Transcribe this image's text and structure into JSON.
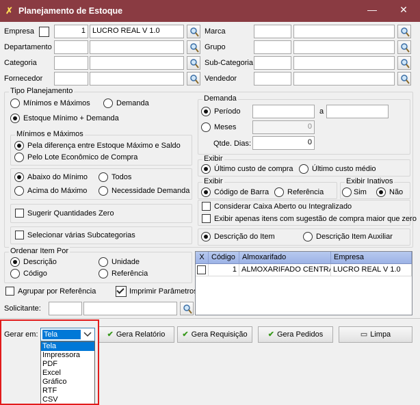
{
  "window": {
    "title": "Planejamento de Estoque",
    "minimize": "—",
    "close": "✕"
  },
  "filters": {
    "empresa": {
      "label": "Empresa",
      "code": "1",
      "name": "LUCRO REAL V 1.0",
      "checked": false
    },
    "departamento": {
      "label": "Departamento",
      "code": "",
      "name": ""
    },
    "categoria": {
      "label": "Categoria",
      "code": "",
      "name": ""
    },
    "fornecedor": {
      "label": "Fornecedor",
      "code": "",
      "name": ""
    },
    "marca": {
      "label": "Marca",
      "code": "",
      "name": ""
    },
    "grupo": {
      "label": "Grupo",
      "code": "",
      "name": ""
    },
    "subcategoria": {
      "label": "Sub-Categoria",
      "code": "",
      "name": ""
    },
    "vendedor": {
      "label": "Vendedor",
      "code": "",
      "name": ""
    }
  },
  "tipo_planejamento": {
    "title": "Tipo Planejamento",
    "opt_minmax": "Mínimos e Máximos",
    "opt_demanda": "Demanda",
    "opt_estoque_demanda": "Estoque Mínimo + Demanda",
    "selected": "Estoque Mínimo + Demanda"
  },
  "minimos_maximos": {
    "title": "Mínimos e Máximos",
    "opt_diferenca": "Pela diferença entre Estoque Máximo e Saldo",
    "opt_lote": "Pelo Lote Econômico de Compra",
    "selected": "Pela diferença entre Estoque Máximo e Saldo"
  },
  "nivel": {
    "opt_abaixo": "Abaixo do Mínimo",
    "opt_todos": "Todos",
    "opt_acima": "Acima do Máximo",
    "opt_necessidade": "Necessidade Demanda",
    "selected": "Abaixo do Mínimo"
  },
  "sugerir": {
    "label": "Sugerir Quantidades Zero",
    "checked": false
  },
  "subcategorias": {
    "label": "Selecionar várias Subcategorias",
    "checked": false
  },
  "demanda": {
    "title": "Demanda",
    "opt_periodo": "Período",
    "opt_meses": "Meses",
    "selected": "Período",
    "periodo_de": "",
    "a_label": "a",
    "periodo_ate": "",
    "meses_value": "0",
    "dias_label": "Qtde. Dias:",
    "dias_value": "0"
  },
  "exibir_custo": {
    "title": "Exibir",
    "opt_ultimo_compra": "Último custo de compra",
    "opt_ultimo_medio": "Último custo médio",
    "selected": "Último custo de compra"
  },
  "exibir_codigo": {
    "title": "Exibir",
    "opt_codigo_barra": "Código de Barra",
    "opt_referencia": "Referência",
    "selected": "Código de Barra"
  },
  "exibir_inativos": {
    "title": "Exibir Inativos",
    "opt_sim": "Sim",
    "opt_nao": "Não",
    "selected": "Não"
  },
  "opcoes": {
    "caixa_aberto": {
      "label": "Considerar Caixa Aberto ou Integralizado",
      "checked": false
    },
    "apenas_sugestao": {
      "label": "Exibir apenas itens com sugestão de compra maior que zero",
      "checked": false
    }
  },
  "descricao": {
    "opt_descricao_item": "Descrição do Item",
    "opt_descricao_auxiliar": "Descrição Item Auxiliar",
    "selected": "Descrição do Item"
  },
  "ordenar": {
    "title": "Ordenar Item Por",
    "opt_descricao": "Descrição",
    "opt_unidade": "Unidade",
    "opt_codigo": "Código",
    "opt_referencia": "Referência",
    "selected": "Descrição"
  },
  "agrupar": {
    "label": "Agrupar por Referência",
    "checked": false
  },
  "imprimir": {
    "label": "Imprimir Parâmetros",
    "checked": true
  },
  "solicitante": {
    "label": "Solicitante:",
    "code": "",
    "name": ""
  },
  "almox_grid": {
    "headers": [
      "X",
      "Código",
      "Almoxarifado",
      "Empresa"
    ],
    "rows": [
      {
        "checked": false,
        "codigo": "1",
        "almoxarifado": "ALMOXARIFADO CENTRAL",
        "empresa": "LUCRO REAL V 1.0"
      }
    ]
  },
  "footer": {
    "gerar_label": "Gerar em:",
    "gerar_value": "Tela",
    "gerar_options": [
      "Tela",
      "Impressora",
      "PDF",
      "Excel",
      "Gráfico",
      "RTF",
      "CSV"
    ],
    "btn_relatorio": "Gera Relatório",
    "btn_requisicao": "Gera Requisição",
    "btn_pedidos": "Gera Pedidos",
    "btn_limpa": "Limpa"
  },
  "colors": {
    "titlebar": "#8a3b42",
    "highlight": "#0078d7",
    "annotation": "#e21b1b"
  }
}
